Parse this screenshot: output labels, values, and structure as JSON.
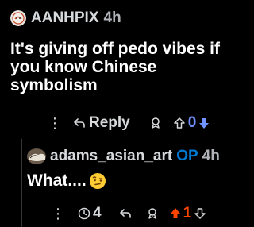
{
  "comments": [
    {
      "author": "AANHPIX",
      "age": "4h",
      "body_lines": [
        "It's giving off pedo vibes if",
        "you know Chinese",
        "symbolism"
      ],
      "actions": {
        "more": "⋮",
        "reply_label": "Reply",
        "score": "0"
      }
    },
    {
      "author": "adams_asian_art",
      "op_badge": "OP",
      "age": "4h",
      "body": "What....",
      "actions": {
        "more": "⋮",
        "awards_count": "4",
        "score": "1"
      }
    }
  ],
  "colors": {
    "upvote_active": "#ff4500",
    "downvote_active": "#7193ff",
    "op_badge": "#0079d3",
    "text_muted": "#d7dadc"
  },
  "icons": [
    "reddit-avatar-icon",
    "artist-avatar-icon",
    "reply-icon",
    "award-icon",
    "upvote-icon",
    "downvote-icon",
    "timer-icon",
    "emoji-raised-eyebrow"
  ]
}
